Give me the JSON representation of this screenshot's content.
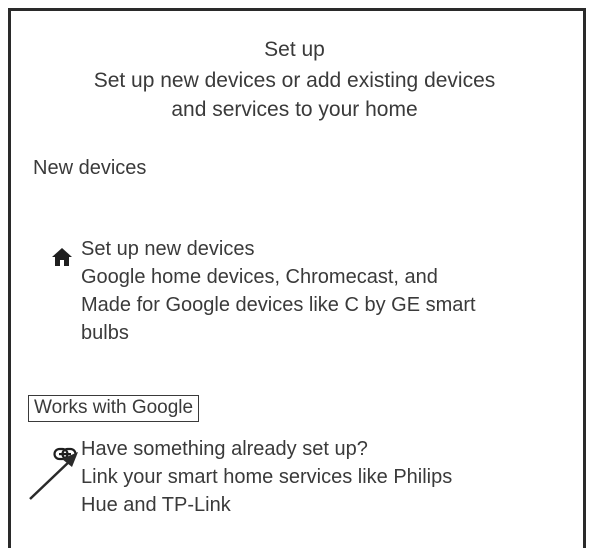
{
  "header": {
    "title": "Set up",
    "subtitle_line1": "Set up new devices or add existing devices",
    "subtitle_line2": "and services to your home"
  },
  "sections": {
    "new_devices": "New devices",
    "works_with_google": "Works with Google"
  },
  "items": {
    "setup_new": {
      "title": "Set up new devices",
      "desc_line1": "Google home devices, Chromecast, and",
      "desc_line2": "Made for Google devices like C by GE smart",
      "desc_line3": "bulbs",
      "icon": "home-icon"
    },
    "link_existing": {
      "title": "Have something already set up?",
      "desc_line1": "Link your smart home services like Philips",
      "desc_line2": "Hue and TP-Link",
      "icon": "link-icon"
    }
  },
  "colors": {
    "text": "#3a3a3a",
    "border": "#2a2a2a"
  }
}
